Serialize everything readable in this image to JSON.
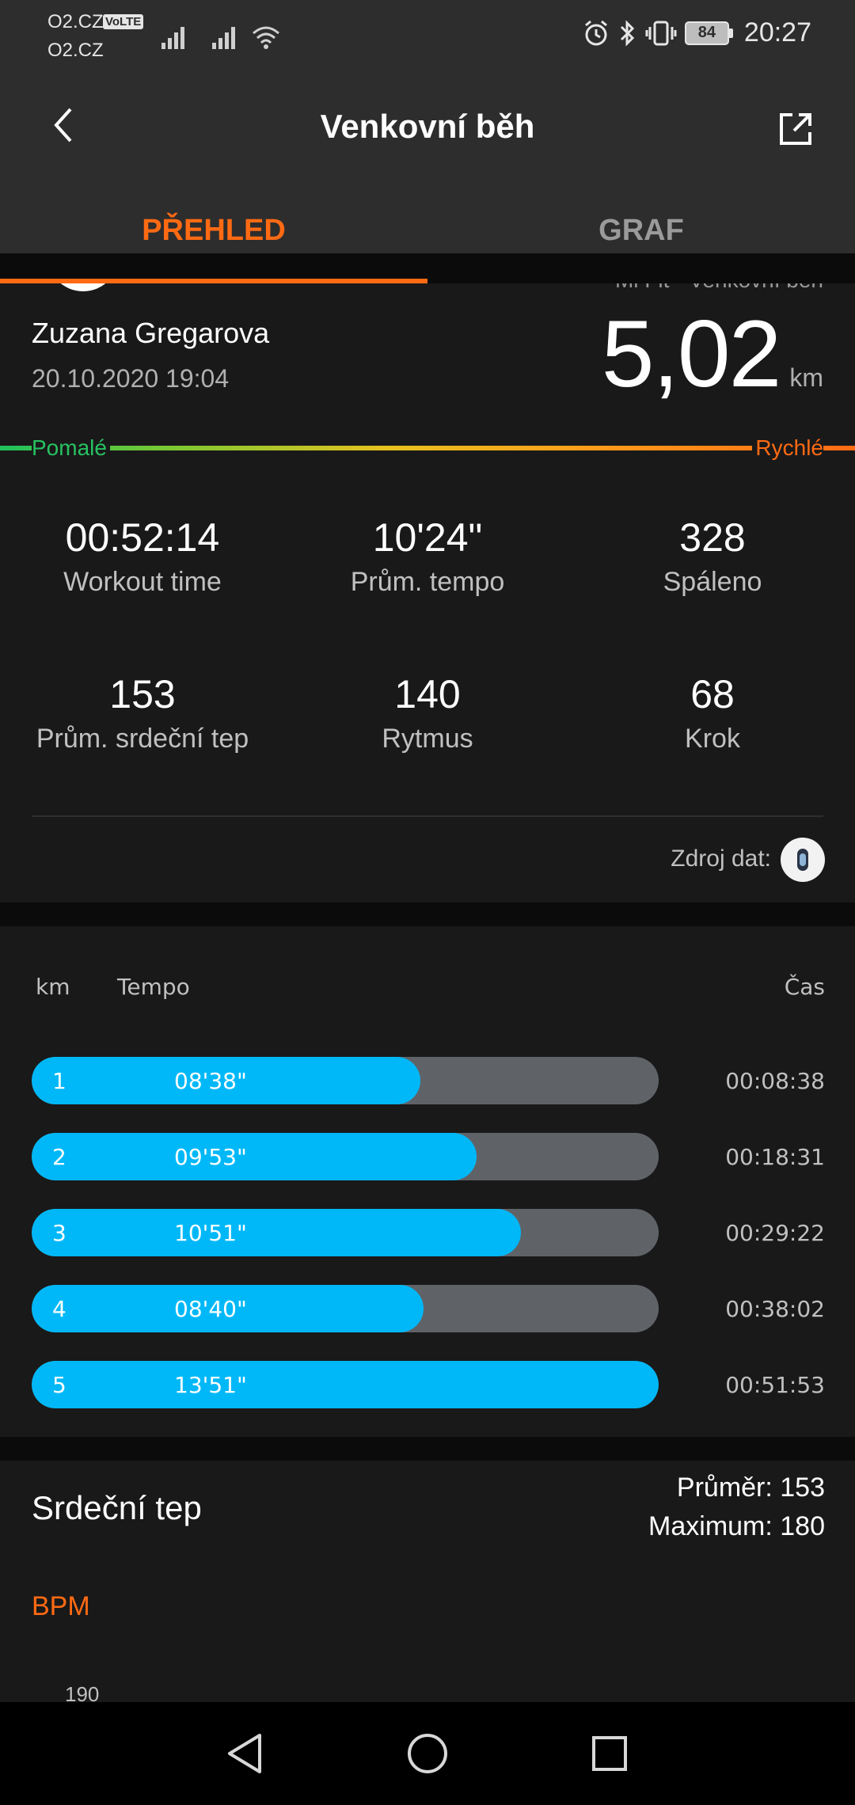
{
  "status_bar": {
    "carrier1": "O2.CZ",
    "carrier2": "O2.CZ",
    "volte": "VoLTE",
    "battery": "84",
    "time": "20:27",
    "icons": [
      "signal-icon",
      "signal-icon",
      "wifi-icon",
      "alarm-icon",
      "bluetooth-icon",
      "vibrate-icon",
      "battery-icon"
    ]
  },
  "header": {
    "title": "Venkovní běh",
    "back_icon": "back-arrow-icon",
    "share_icon": "share-icon"
  },
  "tabs": [
    {
      "label": "PŘEHLED",
      "active": true
    },
    {
      "label": "GRAF",
      "active": false
    }
  ],
  "summary": {
    "device_title_partial": "Mi Fit · Venkovní běh",
    "user_name": "Zuzana Gregarova",
    "date": "20.10.2020 19:04",
    "distance": "5,02",
    "distance_unit": "km",
    "pace_scale": {
      "slow": "Pomalé",
      "fast": "Rychlé"
    },
    "stats": [
      {
        "value": "00:52:14",
        "label": "Workout time"
      },
      {
        "value": "10'24\"",
        "label": "Prům. tempo"
      },
      {
        "value": "328",
        "label": "Spáleno"
      },
      {
        "value": "153",
        "label": "Prům. srdeční tep"
      },
      {
        "value": "140",
        "label": "Rytmus"
      },
      {
        "value": "68",
        "label": "Krok"
      }
    ],
    "source_label": "Zdroj dat:",
    "source_icon": "band-icon"
  },
  "splits": {
    "headers": {
      "km": "km",
      "tempo": "Tempo",
      "time": "Čas"
    },
    "rows": [
      {
        "km": "1",
        "pace": "08'38\"",
        "time": "00:08:38",
        "fraction": 0.62
      },
      {
        "km": "2",
        "pace": "09'53\"",
        "time": "00:18:31",
        "fraction": 0.71
      },
      {
        "km": "3",
        "pace": "10'51\"",
        "time": "00:29:22",
        "fraction": 0.78
      },
      {
        "km": "4",
        "pace": "08'40\"",
        "time": "00:38:02",
        "fraction": 0.625
      },
      {
        "km": "5",
        "pace": "13'51\"",
        "time": "00:51:53",
        "fraction": 1.0
      }
    ],
    "colors": {
      "fill": "#00b8f8",
      "track": "#5f6368"
    }
  },
  "heart_rate": {
    "title": "Srdeční tep",
    "average": "Průměr: 153",
    "maximum": "Maximum: 180",
    "unit": "BPM",
    "axis_top": "190"
  },
  "nav": {
    "icons": [
      "nav-back-icon",
      "nav-home-icon",
      "nav-recent-icon"
    ]
  },
  "colors": {
    "accent": "#ff6a13",
    "slow": "#27c261",
    "panel": "#191919",
    "bar": "#2d2d2d"
  }
}
